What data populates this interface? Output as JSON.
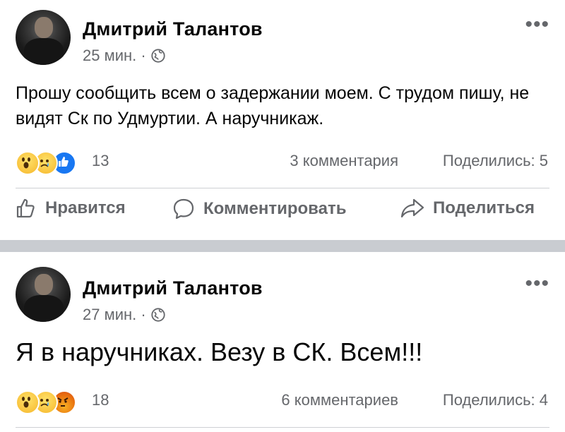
{
  "posts": [
    {
      "author": "Дмитрий Талантов",
      "time": "25 мин. ·",
      "text": "Прошу сообщить всем о задержании моем. С трудом пишу, не видят Ск по Удмуртии. А наручникаж.",
      "reactions": [
        "wow",
        "sad",
        "like"
      ],
      "reaction_count": "13",
      "comments": "3 комментария",
      "shares": "Поделились: 5"
    },
    {
      "author": "Дмитрий Талантов",
      "time": "27 мин. ·",
      "text": "Я в наручниках. Везу в СК. Всем!!!",
      "reactions": [
        "wow",
        "sad",
        "angry"
      ],
      "reaction_count": "18",
      "comments": "6 комментариев",
      "shares": "Поделились: 4"
    }
  ],
  "actions": {
    "like": "Нравится",
    "comment": "Комментировать",
    "share": "Поделиться"
  },
  "icons": {
    "more": "more-options-icon",
    "privacy": "globe-icon",
    "like": "thumbs-up-icon",
    "comment": "comment-bubble-icon",
    "share": "share-arrow-icon"
  },
  "colors": {
    "secondary_text": "#65676b",
    "separator": "#c9ccd1",
    "like_blue": "#1877f2"
  }
}
